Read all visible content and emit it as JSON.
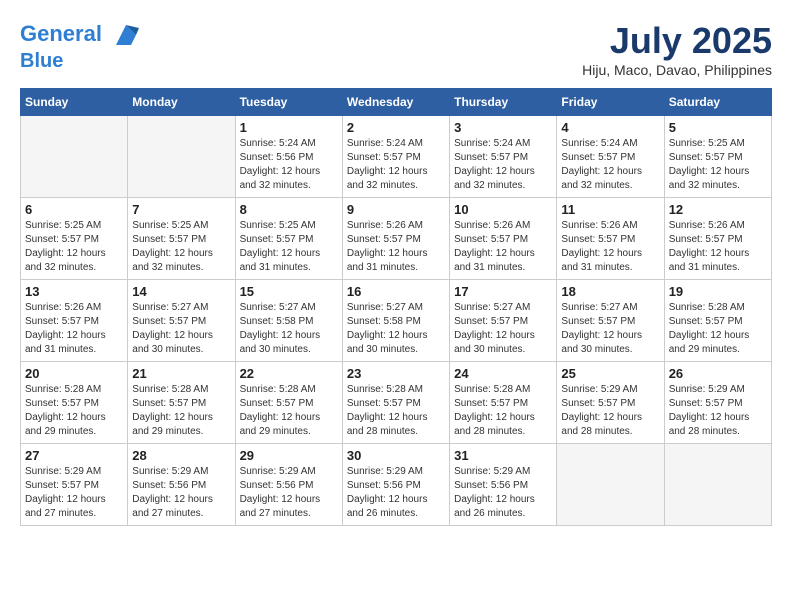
{
  "header": {
    "logo_line1": "General",
    "logo_line2": "Blue",
    "month_title": "July 2025",
    "subtitle": "Hiju, Maco, Davao, Philippines"
  },
  "weekdays": [
    "Sunday",
    "Monday",
    "Tuesday",
    "Wednesday",
    "Thursday",
    "Friday",
    "Saturday"
  ],
  "weeks": [
    [
      {
        "day": "",
        "empty": true
      },
      {
        "day": "",
        "empty": true
      },
      {
        "day": "1",
        "sunrise": "5:24 AM",
        "sunset": "5:56 PM",
        "daylight": "12 hours and 32 minutes."
      },
      {
        "day": "2",
        "sunrise": "5:24 AM",
        "sunset": "5:57 PM",
        "daylight": "12 hours and 32 minutes."
      },
      {
        "day": "3",
        "sunrise": "5:24 AM",
        "sunset": "5:57 PM",
        "daylight": "12 hours and 32 minutes."
      },
      {
        "day": "4",
        "sunrise": "5:24 AM",
        "sunset": "5:57 PM",
        "daylight": "12 hours and 32 minutes."
      },
      {
        "day": "5",
        "sunrise": "5:25 AM",
        "sunset": "5:57 PM",
        "daylight": "12 hours and 32 minutes."
      }
    ],
    [
      {
        "day": "6",
        "sunrise": "5:25 AM",
        "sunset": "5:57 PM",
        "daylight": "12 hours and 32 minutes."
      },
      {
        "day": "7",
        "sunrise": "5:25 AM",
        "sunset": "5:57 PM",
        "daylight": "12 hours and 32 minutes."
      },
      {
        "day": "8",
        "sunrise": "5:25 AM",
        "sunset": "5:57 PM",
        "daylight": "12 hours and 31 minutes."
      },
      {
        "day": "9",
        "sunrise": "5:26 AM",
        "sunset": "5:57 PM",
        "daylight": "12 hours and 31 minutes."
      },
      {
        "day": "10",
        "sunrise": "5:26 AM",
        "sunset": "5:57 PM",
        "daylight": "12 hours and 31 minutes."
      },
      {
        "day": "11",
        "sunrise": "5:26 AM",
        "sunset": "5:57 PM",
        "daylight": "12 hours and 31 minutes."
      },
      {
        "day": "12",
        "sunrise": "5:26 AM",
        "sunset": "5:57 PM",
        "daylight": "12 hours and 31 minutes."
      }
    ],
    [
      {
        "day": "13",
        "sunrise": "5:26 AM",
        "sunset": "5:57 PM",
        "daylight": "12 hours and 31 minutes."
      },
      {
        "day": "14",
        "sunrise": "5:27 AM",
        "sunset": "5:57 PM",
        "daylight": "12 hours and 30 minutes."
      },
      {
        "day": "15",
        "sunrise": "5:27 AM",
        "sunset": "5:58 PM",
        "daylight": "12 hours and 30 minutes."
      },
      {
        "day": "16",
        "sunrise": "5:27 AM",
        "sunset": "5:58 PM",
        "daylight": "12 hours and 30 minutes."
      },
      {
        "day": "17",
        "sunrise": "5:27 AM",
        "sunset": "5:57 PM",
        "daylight": "12 hours and 30 minutes."
      },
      {
        "day": "18",
        "sunrise": "5:27 AM",
        "sunset": "5:57 PM",
        "daylight": "12 hours and 30 minutes."
      },
      {
        "day": "19",
        "sunrise": "5:28 AM",
        "sunset": "5:57 PM",
        "daylight": "12 hours and 29 minutes."
      }
    ],
    [
      {
        "day": "20",
        "sunrise": "5:28 AM",
        "sunset": "5:57 PM",
        "daylight": "12 hours and 29 minutes."
      },
      {
        "day": "21",
        "sunrise": "5:28 AM",
        "sunset": "5:57 PM",
        "daylight": "12 hours and 29 minutes."
      },
      {
        "day": "22",
        "sunrise": "5:28 AM",
        "sunset": "5:57 PM",
        "daylight": "12 hours and 29 minutes."
      },
      {
        "day": "23",
        "sunrise": "5:28 AM",
        "sunset": "5:57 PM",
        "daylight": "12 hours and 28 minutes."
      },
      {
        "day": "24",
        "sunrise": "5:28 AM",
        "sunset": "5:57 PM",
        "daylight": "12 hours and 28 minutes."
      },
      {
        "day": "25",
        "sunrise": "5:29 AM",
        "sunset": "5:57 PM",
        "daylight": "12 hours and 28 minutes."
      },
      {
        "day": "26",
        "sunrise": "5:29 AM",
        "sunset": "5:57 PM",
        "daylight": "12 hours and 28 minutes."
      }
    ],
    [
      {
        "day": "27",
        "sunrise": "5:29 AM",
        "sunset": "5:57 PM",
        "daylight": "12 hours and 27 minutes."
      },
      {
        "day": "28",
        "sunrise": "5:29 AM",
        "sunset": "5:56 PM",
        "daylight": "12 hours and 27 minutes."
      },
      {
        "day": "29",
        "sunrise": "5:29 AM",
        "sunset": "5:56 PM",
        "daylight": "12 hours and 27 minutes."
      },
      {
        "day": "30",
        "sunrise": "5:29 AM",
        "sunset": "5:56 PM",
        "daylight": "12 hours and 26 minutes."
      },
      {
        "day": "31",
        "sunrise": "5:29 AM",
        "sunset": "5:56 PM",
        "daylight": "12 hours and 26 minutes."
      },
      {
        "day": "",
        "empty": true
      },
      {
        "day": "",
        "empty": true
      }
    ]
  ],
  "labels": {
    "sunrise": "Sunrise:",
    "sunset": "Sunset:",
    "daylight": "Daylight:"
  }
}
